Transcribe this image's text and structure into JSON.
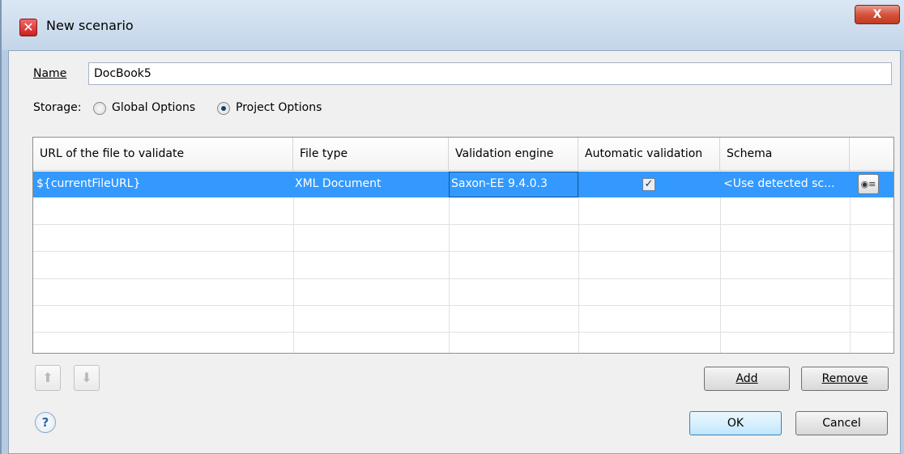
{
  "window": {
    "title": "New scenario",
    "close_label": "X"
  },
  "form": {
    "name_label": "Name",
    "name_value": "DocBook5",
    "storage_label": "Storage:",
    "storage_options": [
      {
        "label": "Global Options",
        "checked": false
      },
      {
        "label": "Project Options",
        "checked": true
      }
    ]
  },
  "table": {
    "columns": [
      "URL of the file to validate",
      "File type",
      "Validation engine",
      "Automatic validation",
      "Schema"
    ],
    "rows": [
      {
        "url": "${currentFileURL}",
        "file_type": "XML Document",
        "engine": "Saxon-EE 9.4.0.3",
        "automatic_validation": true,
        "schema": "<Use detected sc..."
      }
    ]
  },
  "buttons": {
    "move_up_icon": "arrow-up",
    "move_down_icon": "arrow-down",
    "add": "Add",
    "remove": "Remove",
    "ok": "OK",
    "cancel": "Cancel",
    "help": "?"
  }
}
